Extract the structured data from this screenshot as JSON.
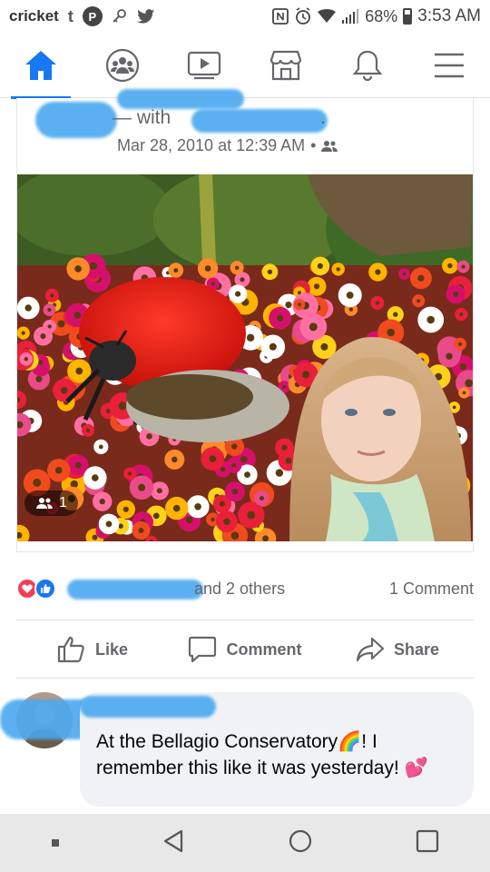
{
  "status_bar": {
    "carrier": "cricket",
    "battery": "68%",
    "time": "3:53 AM"
  },
  "nav": {
    "items": [
      {
        "name": "home",
        "active": true
      },
      {
        "name": "groups",
        "active": false
      },
      {
        "name": "watch",
        "active": false
      },
      {
        "name": "marketplace",
        "active": false
      },
      {
        "name": "notifications",
        "active": false
      },
      {
        "name": "menu",
        "active": false
      }
    ]
  },
  "post": {
    "with_text": "— with",
    "period": ".",
    "date": "Mar 28, 2010 at 12:39 AM",
    "separator": "•",
    "tag_count": "1",
    "photo_alt": "Photo"
  },
  "reactions": {
    "others_text": "and 2 others",
    "comment_count": "1 Comment"
  },
  "actions": {
    "like": "Like",
    "comment": "Comment",
    "share": "Share"
  },
  "comment": {
    "text": "At the Bellagio Conservatory🌈! I remember this like it was yesterday! 💕"
  },
  "colors": {
    "brand": "#1877f2",
    "heart": "#f33e58",
    "secondary_text": "#65676b"
  }
}
